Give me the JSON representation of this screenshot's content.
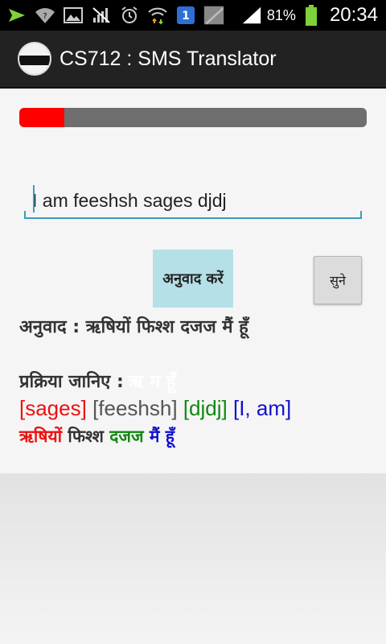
{
  "status_bar": {
    "battery": "81%",
    "time": "20:34",
    "icons": [
      "send-icon",
      "wifi-question-icon",
      "image-icon",
      "no-signal-icon",
      "alarm-icon",
      "wifi-transfer-icon",
      "blue-app-icon",
      "media-icon",
      "signal-icon",
      "battery-icon"
    ]
  },
  "action_bar": {
    "title": "CS712 : SMS Translator"
  },
  "progress": {
    "value": 0.13,
    "fill_color": "#ff0000",
    "track_color": "#6e6e6e"
  },
  "input": {
    "value": "I am feeshsh sages djdj"
  },
  "buttons": {
    "translate_label": "अनुवाद करें",
    "listen_label": "सुने"
  },
  "result": {
    "text": "अनुवाद : ऋषियों फिश्श दजज मैं हूँ"
  },
  "process": {
    "label": "प्रक्रिया जानिए :",
    "faint_text": "ऋ म हूँ",
    "english_tokens": [
      {
        "text": "[sages]",
        "color": "#ee1111"
      },
      {
        "text": "[feeshsh]",
        "color": "#555555"
      },
      {
        "text": "[djdj]",
        "color": "#118811"
      },
      {
        "text": "[I, am]",
        "color": "#1111cc"
      }
    ],
    "hindi_tokens": [
      {
        "text": "ऋषियों",
        "color": "#ee1111"
      },
      {
        "text": "फिश्श",
        "color": "#333333"
      },
      {
        "text": "दजज",
        "color": "#118811"
      },
      {
        "text": "मैं हूँ",
        "color": "#1111cc"
      }
    ]
  }
}
